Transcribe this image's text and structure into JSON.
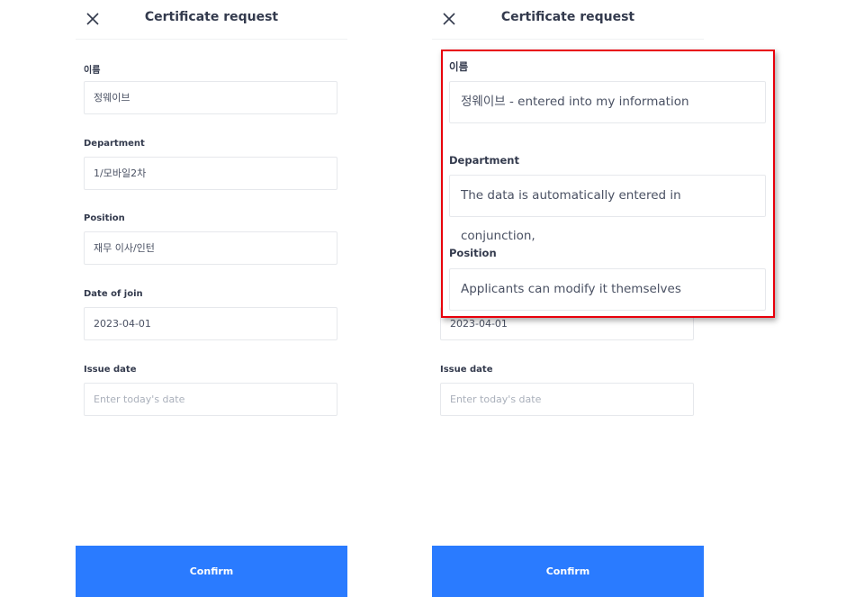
{
  "screens": [
    {
      "title": "Certificate request",
      "fields": [
        {
          "label": "이름",
          "value": "정웨이브"
        },
        {
          "label": "Department",
          "value": "1/모바일2차"
        },
        {
          "label": "Position",
          "value": "재무 이사/인턴"
        },
        {
          "label": "Date of join",
          "value": "2023-04-01"
        },
        {
          "label": "Issue date",
          "placeholder": "Enter today's date"
        }
      ],
      "confirm_label": "Confirm"
    },
    {
      "title": "Certificate request",
      "fields": [
        {
          "label": "Date of join",
          "value": "2023-04-01"
        },
        {
          "label": "Issue date",
          "placeholder": "Enter today's date"
        }
      ],
      "confirm_label": "Confirm"
    }
  ],
  "callout": {
    "highlight_color": "#e8000b",
    "fields": [
      {
        "label": "이름",
        "value": "정웨이브 - entered into my information"
      },
      {
        "label": "Department",
        "value": "The data is automatically entered in conjunction,"
      },
      {
        "label": "Position",
        "value": "Applicants can modify it themselves"
      }
    ]
  },
  "accent_color": "#2a7bff"
}
